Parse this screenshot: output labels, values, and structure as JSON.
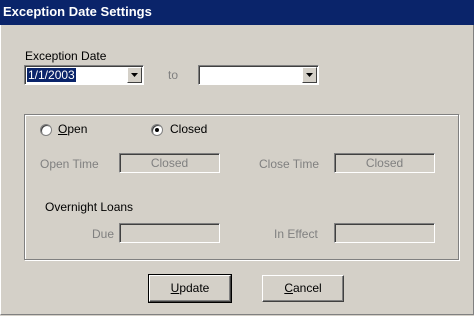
{
  "window": {
    "title": "Exception Date Settings"
  },
  "colors": {
    "titlebar": "#0a246a",
    "selection": "#0a246a",
    "face": "#d4d0c8"
  },
  "exception": {
    "label": "Exception Date",
    "from_value": "1/1/2003",
    "to_label": "to",
    "to_value": ""
  },
  "status": {
    "open_key": "O",
    "open_rest": "pen",
    "closed_label": "Closed",
    "selected": "Closed"
  },
  "times": {
    "open_label": "Open Time",
    "open_value": "Closed",
    "close_label": "Close Time",
    "close_value": "Closed"
  },
  "overnight": {
    "heading": "Overnight Loans",
    "due_label": "Due",
    "due_value": "",
    "in_effect_label": "In Effect",
    "in_effect_value": ""
  },
  "buttons": {
    "update_key": "U",
    "update_rest": "pdate",
    "cancel_key": "C",
    "cancel_rest": "ancel"
  },
  "icons": {
    "dropdown": "chevron-down-icon"
  }
}
